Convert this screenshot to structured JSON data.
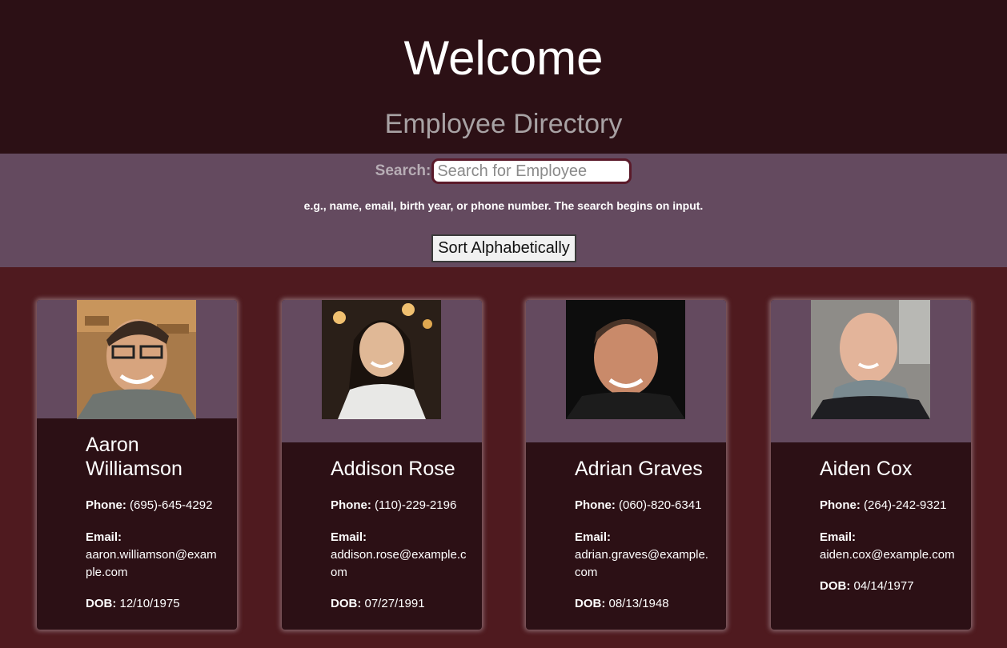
{
  "header": {
    "title": "Welcome",
    "subtitle": "Employee Directory"
  },
  "search": {
    "label": "Search:",
    "placeholder": "Search for Employee",
    "hint": "e.g., name, email, birth year, or phone number. The search begins on input."
  },
  "sort_button": {
    "label": "Sort Alphabetically"
  },
  "field_labels": {
    "phone": "Phone:",
    "email": "Email:",
    "dob": "DOB:"
  },
  "employees": [
    {
      "name": "Aaron Williamson",
      "phone": "(695)-645-4292",
      "email": "aaron.williamson@example.com",
      "dob": "12/10/1975"
    },
    {
      "name": "Addison Rose",
      "phone": "(110)-229-2196",
      "email": "addison.rose@example.com",
      "dob": "07/27/1991"
    },
    {
      "name": "Adrian Graves",
      "phone": "(060)-820-6341",
      "email": "adrian.graves@example.com",
      "dob": "08/13/1948"
    },
    {
      "name": "Aiden Cox",
      "phone": "(264)-242-9321",
      "email": "aiden.cox@example.com",
      "dob": "04/14/1977"
    }
  ],
  "colors": {
    "header_bg": "#2c1015",
    "search_bg": "#644a5f",
    "page_bg": "#4f1a1f",
    "card_bg": "#2c1015"
  }
}
